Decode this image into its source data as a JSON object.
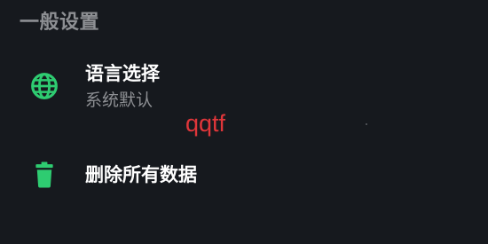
{
  "colors": {
    "background": "#16191e",
    "accent": "#2ecc71",
    "primary_text": "#ffffff",
    "secondary_text": "#8d8f93",
    "overlay_text": "#e0363a"
  },
  "section": {
    "title": "一般设置"
  },
  "settings": {
    "language": {
      "icon": "globe-icon",
      "title": "语言选择",
      "subtitle": "系统默认"
    },
    "delete_all": {
      "icon": "trash-icon",
      "title": "删除所有数据"
    }
  },
  "overlay": {
    "text": "qqtf"
  }
}
